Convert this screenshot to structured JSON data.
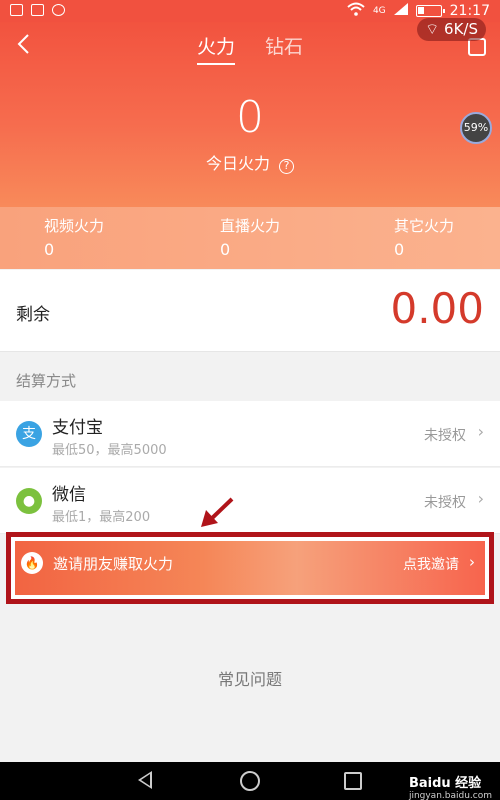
{
  "status_bar": {
    "time": "21:17",
    "network": "4G",
    "net_speed": "6K/S"
  },
  "header": {
    "tabs": [
      {
        "label": "火力"
      },
      {
        "label": "钻石"
      }
    ],
    "today_value": "0",
    "today_label": "今日火力",
    "help_icon_glyph": "?",
    "percent_badge": "59%"
  },
  "stats": [
    {
      "label": "视频火力",
      "value": "0"
    },
    {
      "label": "直播火力",
      "value": "0"
    },
    {
      "label": "其它火力",
      "value": "0"
    }
  ],
  "balance": {
    "label": "剩余",
    "amount": "0.00"
  },
  "settlement": {
    "title": "结算方式",
    "methods": [
      {
        "name": "支付宝",
        "limit": "最低50，最高5000",
        "status": "未授权",
        "icon_glyph": "支",
        "color": "#3aa3e3"
      },
      {
        "name": "微信",
        "limit": "最低1，最高200",
        "status": "未授权",
        "icon_glyph": "●",
        "color": "#7cc13e"
      }
    ]
  },
  "invite": {
    "text": "邀请朋友赚取火力",
    "action": "点我邀请"
  },
  "faq": {
    "label": "常见问题"
  },
  "watermark": {
    "brand": "Baidu 经验",
    "url": "jingyan.baidu.com"
  },
  "colors": {
    "accent": "#f2533f",
    "amount": "#d43a2b",
    "highlight_border": "#b0141a"
  }
}
